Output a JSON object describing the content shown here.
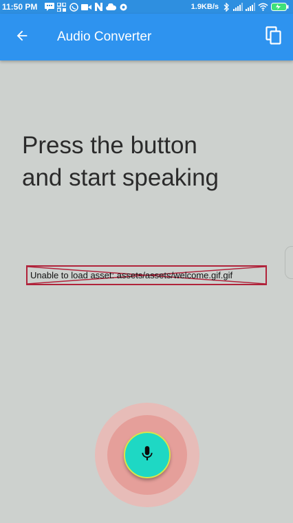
{
  "status_bar": {
    "time": "11:50 PM",
    "net_speed": "1.9KB/s",
    "notification_icons": [
      "message-icon",
      "grid-icon",
      "whatsapp-icon",
      "video-icon",
      "n-icon",
      "cloud-icon",
      "dot-icon"
    ],
    "status_icons": [
      "bluetooth-icon",
      "signal-icon",
      "signal-icon",
      "wifi-icon",
      "battery-icon"
    ]
  },
  "app_bar": {
    "title": "Audio Converter",
    "back_icon": "arrow-back-icon",
    "action_icon": "copy-icon",
    "color": "#2e93ef"
  },
  "main": {
    "prompt_line1": "Press the button",
    "prompt_line2": "and start speaking",
    "error_text": "Unable to load asset: assets/assets/welcome.gif.gif",
    "background": "#cdd1ce"
  },
  "mic": {
    "icon": "microphone-icon",
    "color": "#1ed8c4",
    "glow_color": "#e59f9a"
  }
}
